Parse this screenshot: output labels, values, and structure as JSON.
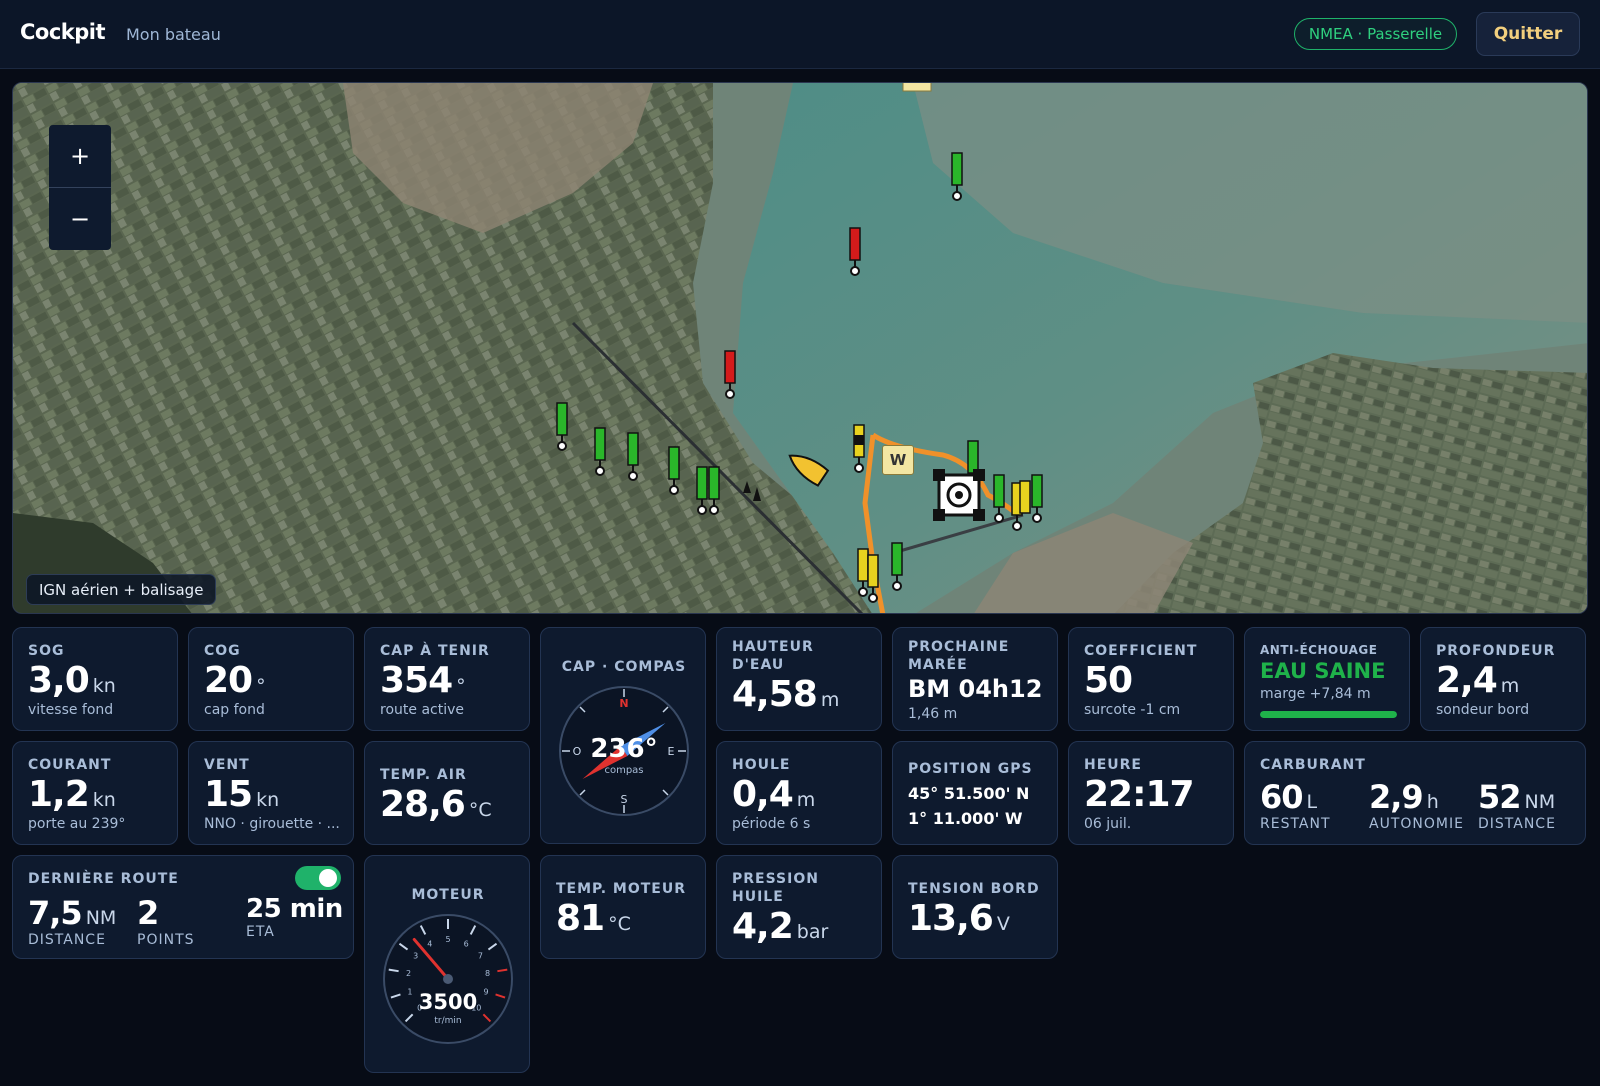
{
  "header": {
    "brand": "Cockpit",
    "subtitle": "Mon bateau",
    "nmea_badge": "NMEA · Passerelle",
    "quit_label": "Quitter"
  },
  "map": {
    "zoom_in": "+",
    "zoom_out": "−",
    "layer_label": "IGN aérien + balisage",
    "waypoint_letter": "W"
  },
  "cards": {
    "sog": {
      "label": "SOG",
      "value": "3,0",
      "unit": "kn",
      "sub": "vitesse fond"
    },
    "cog": {
      "label": "COG",
      "value": "20",
      "unit": "°",
      "sub": "cap fond"
    },
    "cap_tenir": {
      "label": "CAP À TENIR",
      "value": "354",
      "unit": "°",
      "sub": "route active"
    },
    "compass": {
      "label": "CAP · COMPAS",
      "value": "236°",
      "sub": "compas",
      "heading_deg": 236,
      "cardinals": {
        "n": "N",
        "e": "E",
        "s": "S",
        "o": "O"
      }
    },
    "hauteur": {
      "label_1": "HAUTEUR",
      "label_2": "D'EAU",
      "value": "4,58",
      "unit": "m"
    },
    "maree": {
      "label_1": "PROCHAINE",
      "label_2": "MARÉE",
      "value": "BM 04h12",
      "sub": "1,46 m"
    },
    "coef": {
      "label": "COEFFICIENT",
      "value": "50",
      "sub": "surcote -1 cm"
    },
    "anti": {
      "label": "ANTI-ÉCHOUAGE",
      "status": "EAU SAINE",
      "sub": "marge +7,84 m",
      "level": 1.0,
      "color": "#1fb24a"
    },
    "profondeur": {
      "label": "PROFONDEUR",
      "value": "2,4",
      "unit": "m",
      "sub": "sondeur bord"
    },
    "courant": {
      "label": "COURANT",
      "value": "1,2",
      "unit": "kn",
      "sub": "porte au 239°"
    },
    "vent": {
      "label": "VENT",
      "value": "15",
      "unit": "kn",
      "sub": "NNO · girouette · ..."
    },
    "temp_air": {
      "label": "TEMP. AIR",
      "value": "28,6",
      "unit": "°C"
    },
    "houle": {
      "label": "HOULE",
      "value": "0,4",
      "unit": "m",
      "sub": "période 6 s"
    },
    "gps": {
      "label": "POSITION GPS",
      "lat": "45° 51.500' N",
      "lon": "1° 11.000' W"
    },
    "heure": {
      "label": "HEURE",
      "value": "22:17",
      "sub": "06 juil."
    },
    "carburant": {
      "label": "CARBURANT",
      "restant_value": "60",
      "restant_unit": "L",
      "restant_label": "RESTANT",
      "autonomie_value": "2,9",
      "autonomie_unit": "h",
      "autonomie_label": "AUTONOMIE",
      "distance_value": "52",
      "distance_unit": "NM",
      "distance_label": "DISTANCE"
    },
    "route": {
      "label": "DERNIÈRE ROUTE",
      "toggle_on": true,
      "distance_value": "7,5",
      "distance_unit": "NM",
      "distance_label": "DISTANCE",
      "points_value": "2",
      "points_label": "POINTS",
      "eta_value": "25 min",
      "eta_label": "ETA"
    },
    "moteur": {
      "label": "MOTEUR",
      "value": "3500",
      "unit": "tr/min",
      "rpm_fraction": 0.35,
      "ticks": [
        "0",
        "1",
        "2",
        "3",
        "4",
        "5",
        "6",
        "7",
        "8",
        "9",
        "10"
      ]
    },
    "temp_moteur": {
      "label": "TEMP. MOTEUR",
      "value": "81",
      "unit": "°C"
    },
    "pression": {
      "label_1": "PRESSION",
      "label_2": "HUILE",
      "value": "4,2",
      "unit": "bar"
    },
    "tension": {
      "label": "TENSION BORD",
      "value": "13,6",
      "unit": "V"
    }
  },
  "colors": {
    "accent": "#f2cf7e",
    "ok": "#1fb24a",
    "route": "#f0912a"
  }
}
